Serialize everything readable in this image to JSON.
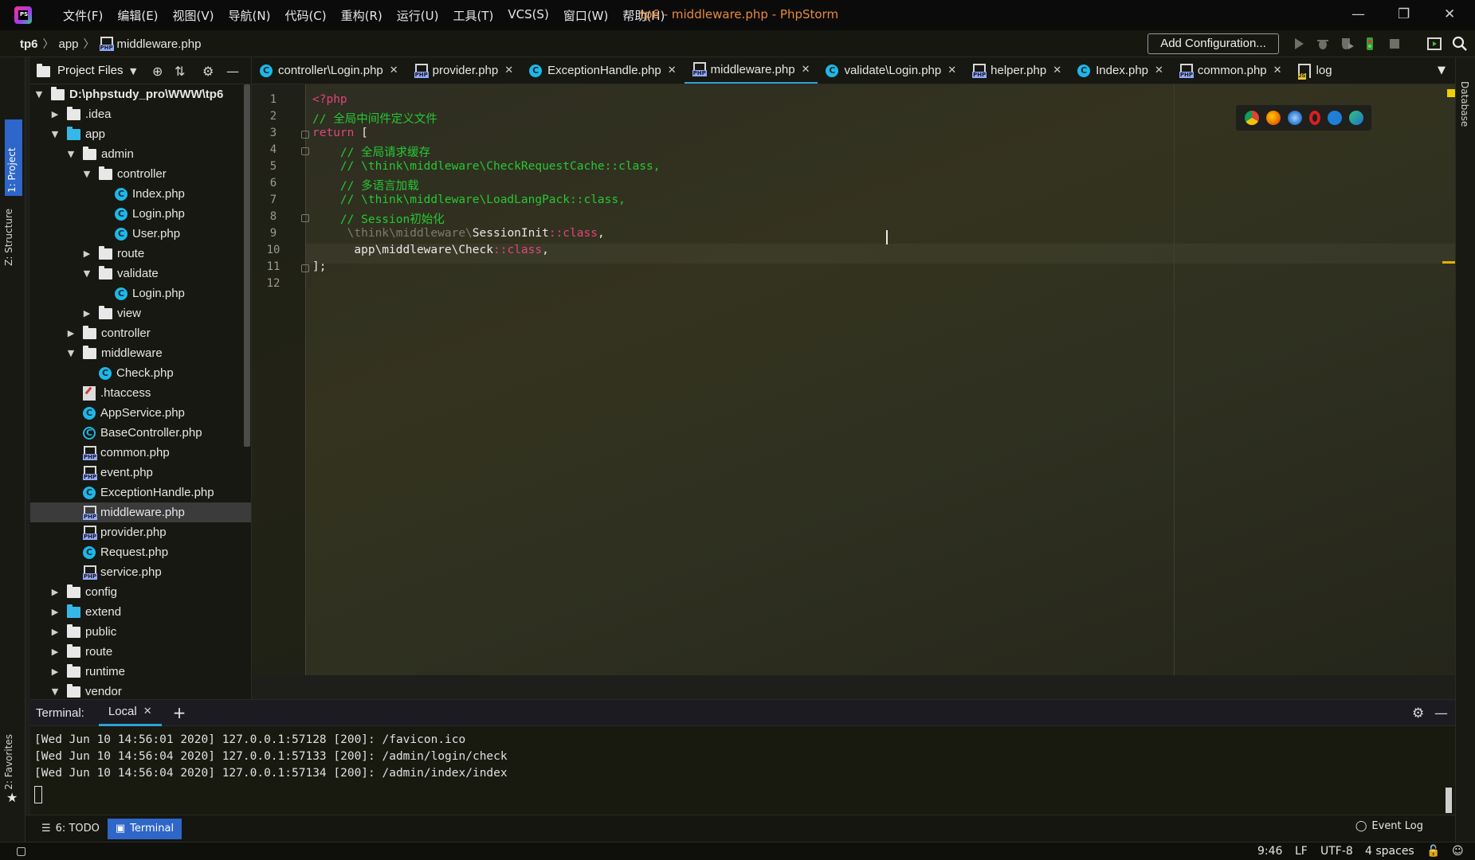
{
  "window": {
    "title": "tp6 - middleware.php - PhpStorm",
    "menu": [
      "文件(F)",
      "编辑(E)",
      "视图(V)",
      "导航(N)",
      "代码(C)",
      "重构(R)",
      "运行(U)",
      "工具(T)",
      "VCS(S)",
      "窗口(W)",
      "帮助(H)"
    ],
    "minimize": "—",
    "restore": "❐",
    "close": "✕"
  },
  "navbar": {
    "breadcrumb": [
      "tp6",
      "app",
      "middleware.php"
    ],
    "add_configuration": "Add Configuration..."
  },
  "left_strip": {
    "project_tab": "1: Project",
    "structure_tab": "Z: Structure",
    "favorites_tab": "2: Favorites"
  },
  "right_strip": {
    "database_tab": "Database"
  },
  "project_panel": {
    "title": "Project Files",
    "tree": [
      {
        "label": "D:\\phpstudy_pro\\WWW\\tp6",
        "depth": 0,
        "type": "folder",
        "expanded": true,
        "bold": true
      },
      {
        "label": ".idea",
        "depth": 1,
        "type": "folder",
        "expanded": false
      },
      {
        "label": "app",
        "depth": 1,
        "type": "folder-blue",
        "expanded": true
      },
      {
        "label": "admin",
        "depth": 2,
        "type": "folder",
        "expanded": true
      },
      {
        "label": "controller",
        "depth": 3,
        "type": "folder",
        "expanded": true
      },
      {
        "label": "Index.php",
        "depth": 4,
        "type": "class"
      },
      {
        "label": "Login.php",
        "depth": 4,
        "type": "class"
      },
      {
        "label": "User.php",
        "depth": 4,
        "type": "class"
      },
      {
        "label": "route",
        "depth": 3,
        "type": "folder",
        "expanded": false
      },
      {
        "label": "validate",
        "depth": 3,
        "type": "folder",
        "expanded": true
      },
      {
        "label": "Login.php",
        "depth": 4,
        "type": "class"
      },
      {
        "label": "view",
        "depth": 3,
        "type": "folder",
        "expanded": false
      },
      {
        "label": "controller",
        "depth": 2,
        "type": "folder",
        "expanded": false
      },
      {
        "label": "middleware",
        "depth": 2,
        "type": "folder",
        "expanded": true
      },
      {
        "label": "Check.php",
        "depth": 3,
        "type": "class"
      },
      {
        "label": ".htaccess",
        "depth": 2,
        "type": "htaccess"
      },
      {
        "label": "AppService.php",
        "depth": 2,
        "type": "class"
      },
      {
        "label": "BaseController.php",
        "depth": 2,
        "type": "class-abstract"
      },
      {
        "label": "common.php",
        "depth": 2,
        "type": "php"
      },
      {
        "label": "event.php",
        "depth": 2,
        "type": "php"
      },
      {
        "label": "ExceptionHandle.php",
        "depth": 2,
        "type": "class"
      },
      {
        "label": "middleware.php",
        "depth": 2,
        "type": "php",
        "selected": true
      },
      {
        "label": "provider.php",
        "depth": 2,
        "type": "php"
      },
      {
        "label": "Request.php",
        "depth": 2,
        "type": "class"
      },
      {
        "label": "service.php",
        "depth": 2,
        "type": "php"
      },
      {
        "label": "config",
        "depth": 1,
        "type": "folder",
        "expanded": false
      },
      {
        "label": "extend",
        "depth": 1,
        "type": "folder-blue",
        "expanded": false
      },
      {
        "label": "public",
        "depth": 1,
        "type": "folder",
        "expanded": false
      },
      {
        "label": "route",
        "depth": 1,
        "type": "folder",
        "expanded": false
      },
      {
        "label": "runtime",
        "depth": 1,
        "type": "folder",
        "expanded": false
      },
      {
        "label": "vendor",
        "depth": 1,
        "type": "folder",
        "expanded": true
      }
    ]
  },
  "editor_tabs": [
    {
      "label": "controller\\Login.php",
      "icon": "class"
    },
    {
      "label": "provider.php",
      "icon": "php"
    },
    {
      "label": "ExceptionHandle.php",
      "icon": "class"
    },
    {
      "label": "middleware.php",
      "icon": "php",
      "active": true
    },
    {
      "label": "validate\\Login.php",
      "icon": "class"
    },
    {
      "label": "helper.php",
      "icon": "php"
    },
    {
      "label": "Index.php",
      "icon": "class"
    },
    {
      "label": "common.php",
      "icon": "php"
    },
    {
      "label": "log",
      "icon": "js"
    }
  ],
  "editor": {
    "line_numbers": [
      "1",
      "2",
      "3",
      "4",
      "5",
      "6",
      "7",
      "8",
      "9",
      "10",
      "11",
      "12"
    ],
    "code": {
      "l1": "<?php",
      "l2": "// 全局中间件定义文件",
      "l3_kw": "return",
      "l3_rest": " [",
      "l4": "    // 全局请求缓存",
      "l5": "    // \\think\\middleware\\CheckRequestCache::class,",
      "l6": "    // 多语言加载",
      "l7": "    // \\think\\middleware\\LoadLangPack::class,",
      "l8": "    // Session初始化",
      "l9_dim": "     \\think\\middleware\\",
      "l9_name": "SessionInit",
      "l9_class": "::class",
      "l9_end": ",",
      "l10_name": "      app\\middleware\\Check",
      "l10_class": "::class",
      "l10_end": ",",
      "l11": "];"
    }
  },
  "terminal": {
    "title": "Terminal:",
    "tab": "Local",
    "lines": [
      "[Wed Jun 10 14:56:01 2020] 127.0.0.1:57128 [200]: /favicon.ico",
      "[Wed Jun 10 14:56:04 2020] 127.0.0.1:57133 [200]: /admin/login/check",
      "[Wed Jun 10 14:56:04 2020] 127.0.0.1:57134 [200]: /admin/index/index"
    ]
  },
  "bottom_tools": {
    "todo": "6: TODO",
    "terminal": "Terminal",
    "event_log": "Event Log"
  },
  "status": {
    "position": "9:46",
    "line_sep": "LF",
    "encoding": "UTF-8",
    "indent": "4 spaces"
  }
}
